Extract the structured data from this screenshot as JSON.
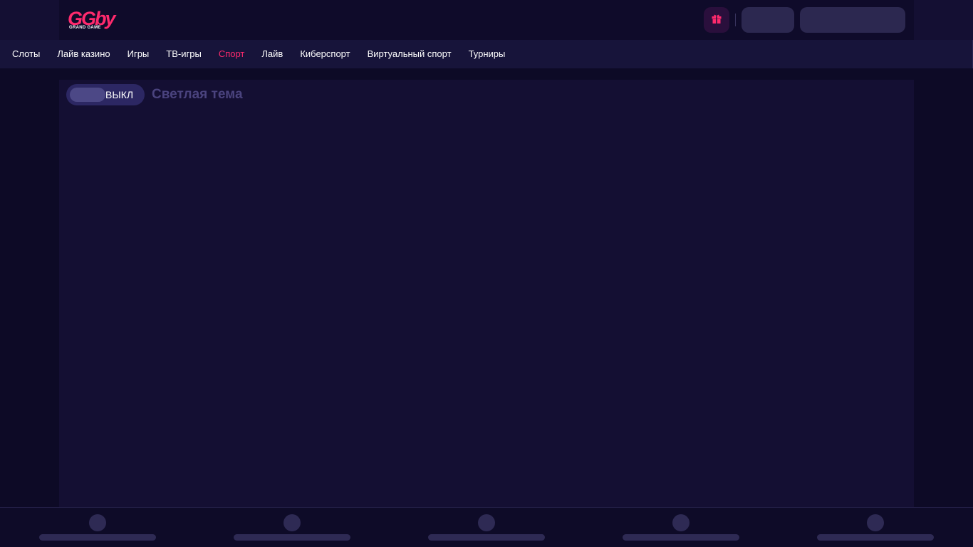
{
  "header": {
    "logo_text": "GGby",
    "logo_subtext": "GRAND GAME",
    "brand_color": "#ff2a6d",
    "gift_icon": "gift-icon"
  },
  "nav": {
    "items": [
      {
        "label": "Слоты",
        "active": false
      },
      {
        "label": "Лайв казино",
        "active": false
      },
      {
        "label": "Игры",
        "active": false
      },
      {
        "label": "ТВ-игры",
        "active": false
      },
      {
        "label": "Спорт",
        "active": true
      },
      {
        "label": "Лайв",
        "active": false
      },
      {
        "label": "Киберспорт",
        "active": false
      },
      {
        "label": "Виртуальный спорт",
        "active": false
      },
      {
        "label": "Турниры",
        "active": false
      }
    ]
  },
  "theme": {
    "toggle_state": "ВЫКЛ",
    "label": "Светлая тема"
  },
  "colors": {
    "background": "#0d0a26",
    "panel": "#140f33",
    "accent": "#ff2a6d",
    "skeleton": "#2c2850"
  }
}
